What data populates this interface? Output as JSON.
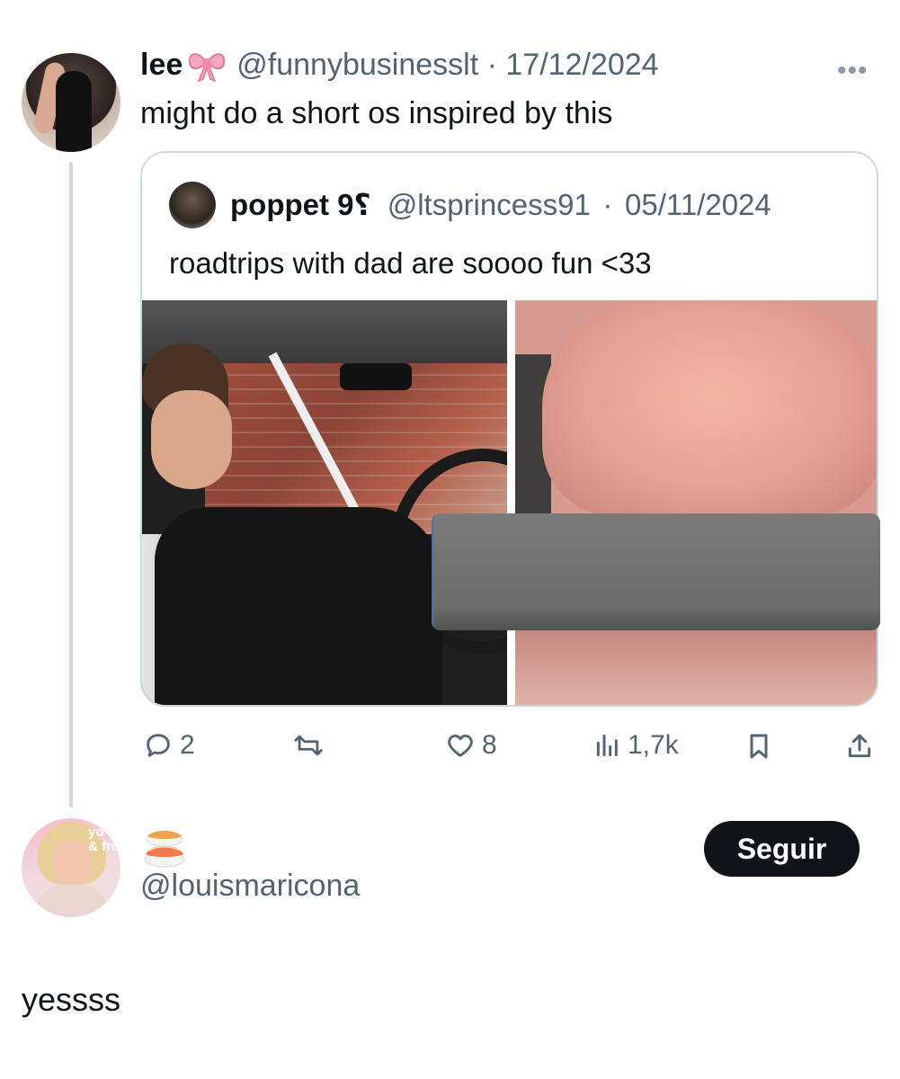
{
  "tweet": {
    "author_name": "lee",
    "author_emoji_icon": "bow-emoji",
    "handle": "@funnybusinesslt",
    "date": "17/12/2024",
    "text": "might do a short os inspired by this",
    "more_label": "•••"
  },
  "quote": {
    "author_name": "poppet 9⸮",
    "handle": "@ltsprincess91",
    "date": "05/11/2024",
    "text": "roadtrips with dad are soooo fun <33",
    "images": [
      {
        "icon": "photo-man-in-car"
      },
      {
        "icon": "photo-censored"
      }
    ]
  },
  "actions": {
    "replies": "2",
    "retweets": "",
    "likes": "8",
    "views": "1,7k"
  },
  "reply_user": {
    "display_emoji_icon": "sushi-emoji",
    "handle": "@louismaricona",
    "follow_label": "Seguir",
    "avatar_overlay_text": "yo\n& fre"
  },
  "reply_text": "yessss",
  "colors": {
    "text": "#0f1419",
    "secondary": "#536471",
    "border": "#cfd9de",
    "button": "#0f1419"
  }
}
